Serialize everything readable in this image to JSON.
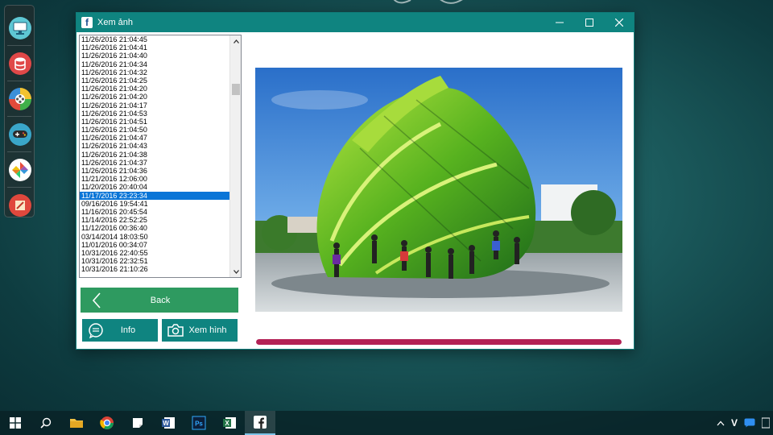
{
  "window": {
    "title": "Xem ảnh",
    "app_icon": "f"
  },
  "list": {
    "items": [
      "11/26/2016 21:04:45",
      "11/26/2016 21:04:41",
      "11/26/2016 21:04:40",
      "11/26/2016 21:04:34",
      "11/26/2016 21:04:32",
      "11/26/2016 21:04:25",
      "11/26/2016 21:04:20",
      "11/26/2016 21:04:20",
      "11/26/2016 21:04:17",
      "11/26/2016 21:04:53",
      "11/26/2016 21:04:51",
      "11/26/2016 21:04:50",
      "11/26/2016 21:04:47",
      "11/26/2016 21:04:43",
      "11/26/2016 21:04:38",
      "11/26/2016 21:04:37",
      "11/26/2016 21:04:36",
      "11/21/2016 12:06:00",
      "11/20/2016 20:40:04",
      "11/17/2016 23:23:34",
      "09/16/2016 19:54:41",
      "11/16/2016 20:45:54",
      "11/14/2016 22:52:25",
      "11/12/2016 00:36:40",
      "03/14/2014 18:03:50",
      "11/01/2016 00:34:07",
      "10/31/2016 22:40:55",
      "10/31/2016 22:32:51",
      "10/31/2016 21:10:26"
    ],
    "selected_index": 19
  },
  "buttons": {
    "back": "Back",
    "info": "Info",
    "view": "Xem hình"
  },
  "progress": {
    "value": 1.0,
    "color": "#b32155"
  },
  "colors": {
    "titlebar": "#0f8480",
    "back_button": "#2e9a60",
    "small_buttons": "#0f8480",
    "selection": "#0a75d7"
  },
  "dock": {
    "icons": [
      "monitor-icon",
      "database-icon",
      "film-reel-icon",
      "gamepad-icon",
      "pinwheel-icon",
      "notepad-icon"
    ]
  },
  "taskbar": {
    "icons": [
      "start-icon",
      "search-icon",
      "file-explorer-icon",
      "chrome-icon",
      "sticky-notes-icon",
      "word-icon",
      "photoshop-icon",
      "excel-icon",
      "facebook-app-icon"
    ],
    "tray_icons": [
      "tray-chevron-icon",
      "tray-v-icon",
      "tray-zalo-icon",
      "tray-language-icon"
    ],
    "tray_v_label": "V"
  }
}
